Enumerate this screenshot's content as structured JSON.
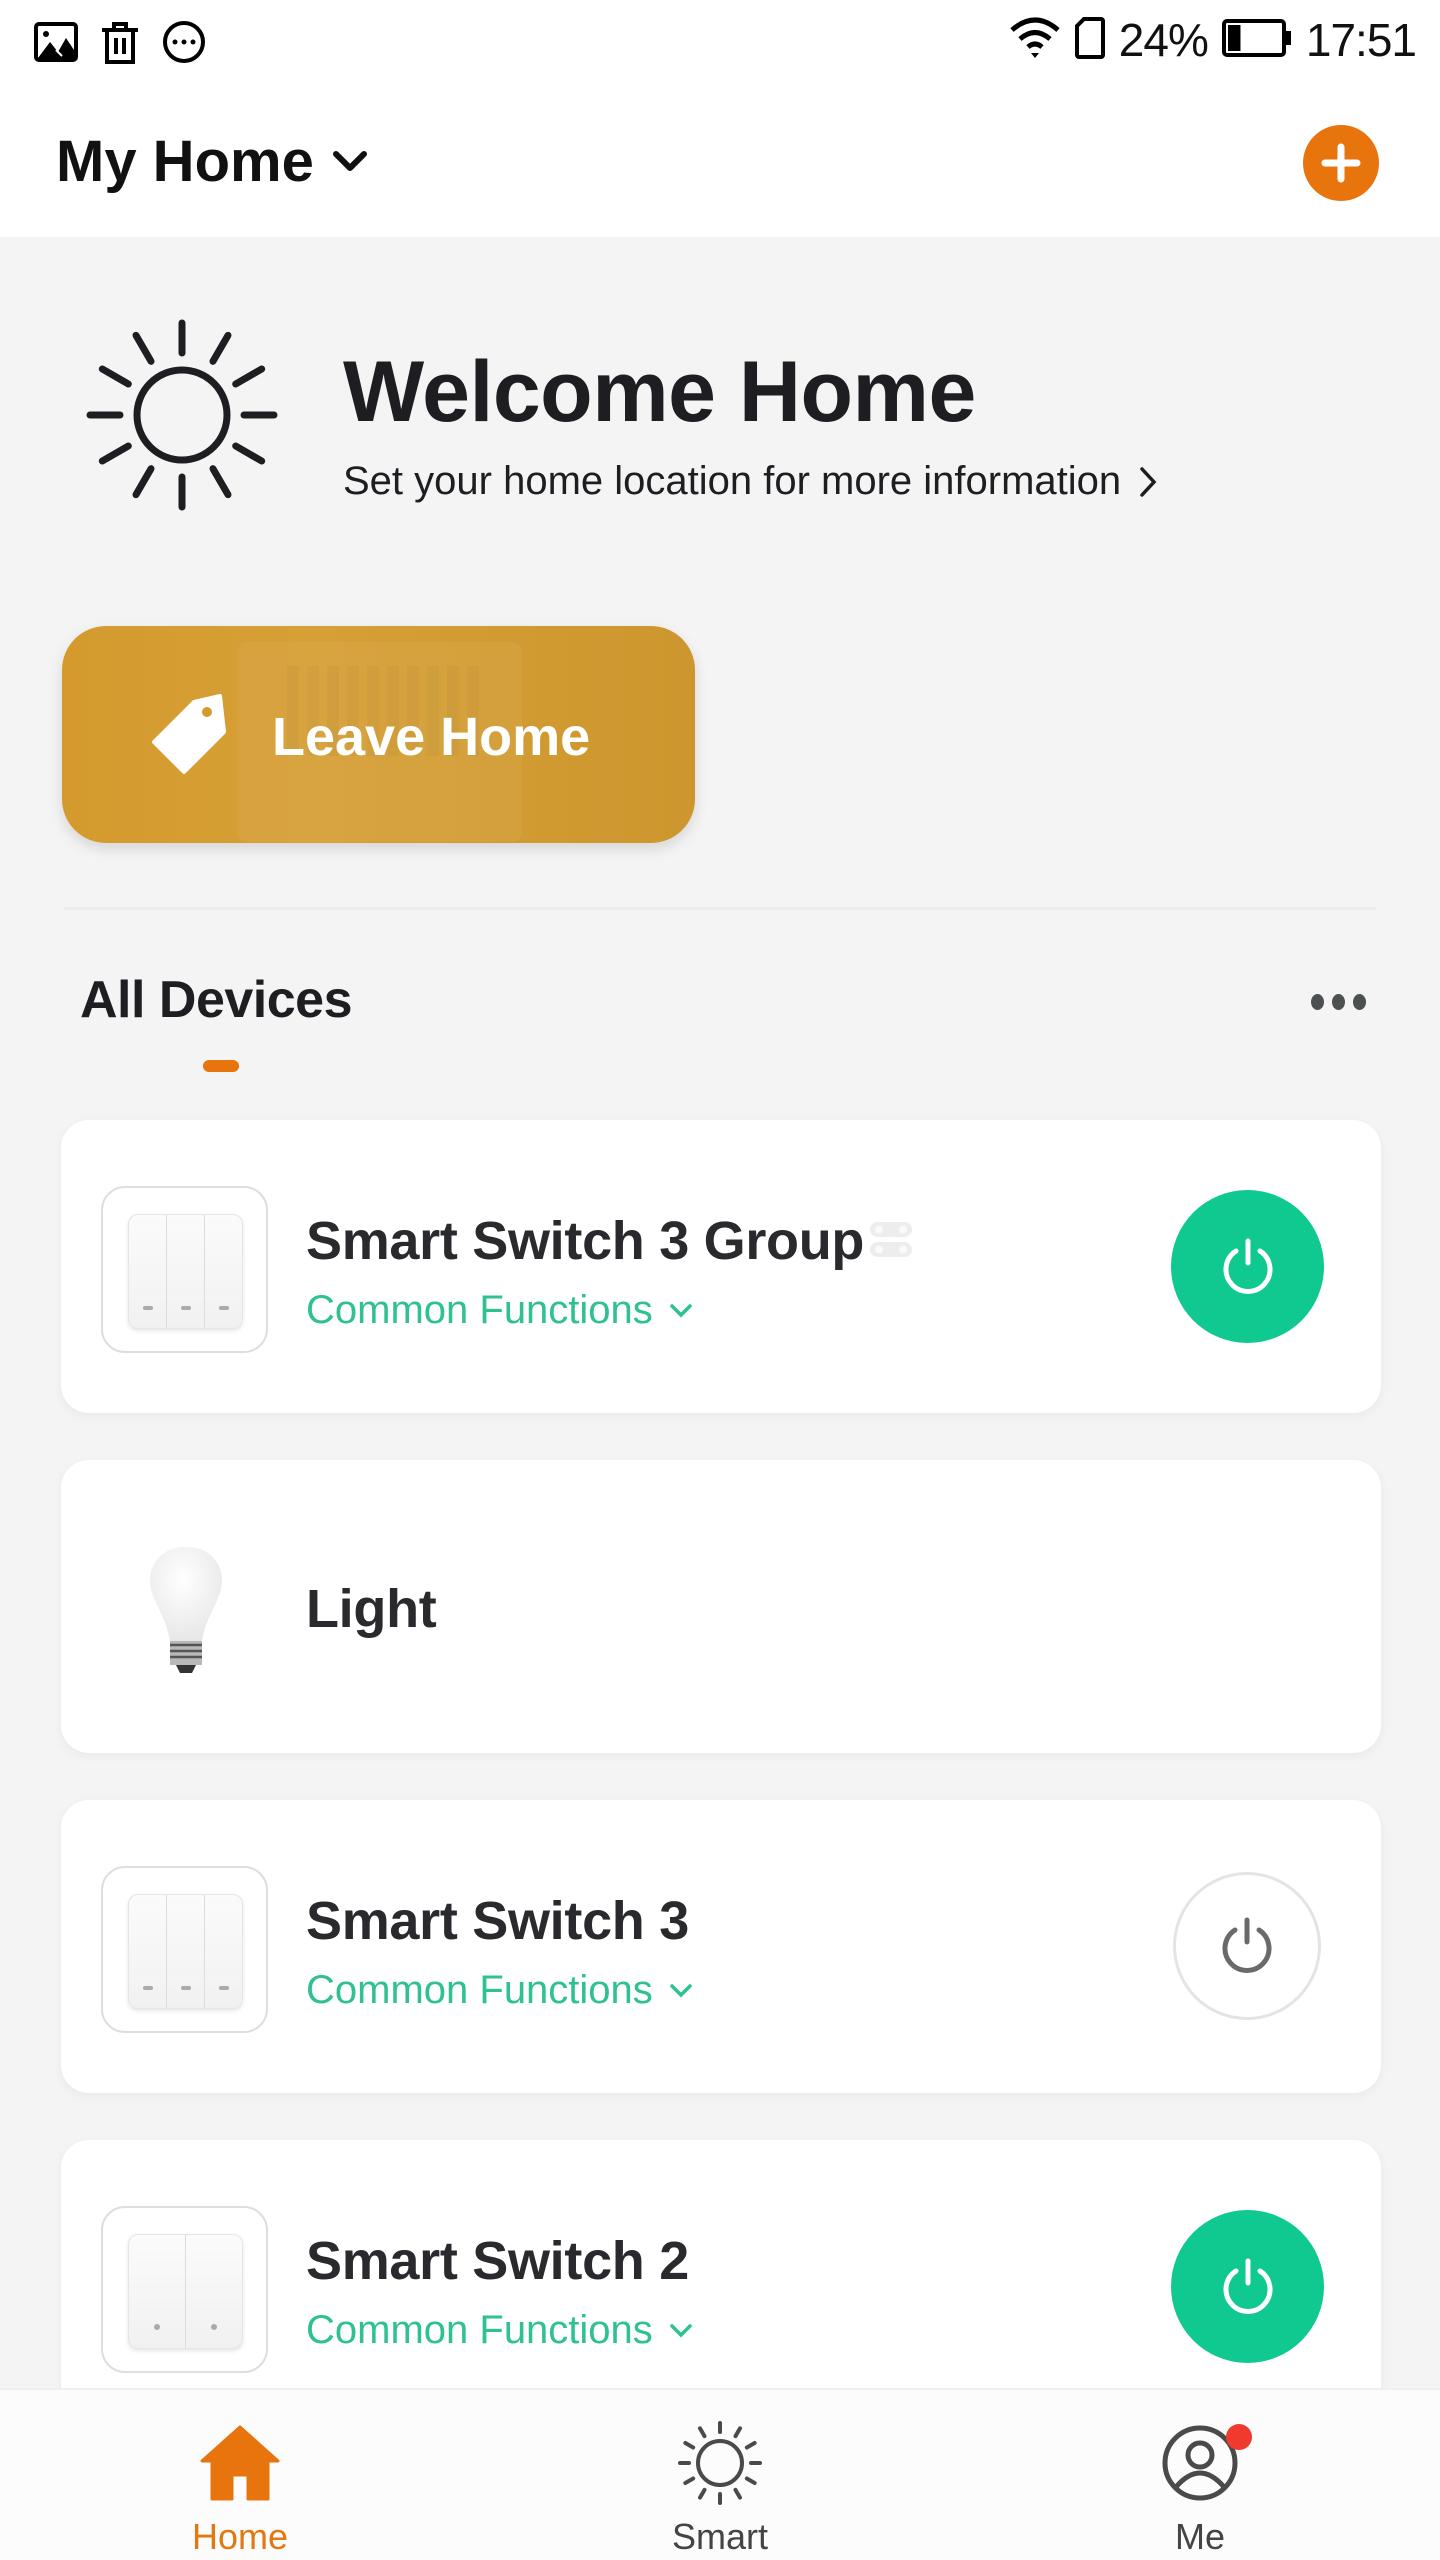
{
  "status_bar": {
    "left_icons": [
      "gallery-icon",
      "trash-icon",
      "more-circle-icon"
    ],
    "wifi": "wifi-icon",
    "sim": "sim-card-icon",
    "battery_percent": "24%",
    "battery_level": 0.24,
    "time": "17:51"
  },
  "header": {
    "home_name": "My Home",
    "home_dropdown_icon": "chevron-down-icon",
    "add_icon": "plus-icon"
  },
  "welcome": {
    "icon": "sun-icon",
    "title": "Welcome Home",
    "subtitle": "Set your home location for more information",
    "subtitle_icon": "chevron-right-icon"
  },
  "scene": {
    "label": "Leave Home",
    "icon": "tag-icon"
  },
  "devices_section": {
    "title": "All Devices",
    "more_icon": "more-horizontal-icon"
  },
  "devices": [
    {
      "name": "Smart Switch 3 Group",
      "subtitle": "Common Functions",
      "type": "switch-3-gang",
      "is_group": true,
      "power": "on"
    },
    {
      "name": "Light",
      "subtitle": "",
      "type": "bulb",
      "is_group": false,
      "power": "none"
    },
    {
      "name": "Smart Switch 3",
      "subtitle": "Common Functions",
      "type": "switch-3-gang",
      "is_group": false,
      "power": "off"
    },
    {
      "name": "Smart Switch 2",
      "subtitle": "Common Functions",
      "type": "switch-2-gang",
      "is_group": false,
      "power": "on"
    }
  ],
  "bottom_nav": {
    "items": [
      {
        "label": "Home",
        "icon": "home-icon",
        "active": true
      },
      {
        "label": "Smart",
        "icon": "sun-icon",
        "active": false
      },
      {
        "label": "Me",
        "icon": "user-icon",
        "active": false,
        "badge": true
      }
    ]
  },
  "colors": {
    "accent_orange": "#e8740e",
    "power_on_green": "#0fc990",
    "link_green": "#2fc18e",
    "scene_gold": "#d49a2e",
    "notification_red": "#f03a2e",
    "background": "#f4f4f4"
  }
}
